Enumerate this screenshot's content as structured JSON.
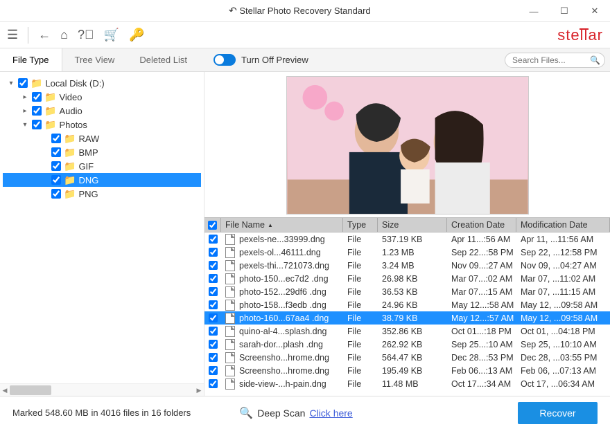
{
  "title": "Stellar Photo Recovery Standard",
  "brand": "stellar",
  "toolbar": {
    "preview_toggle_label": "Turn Off Preview"
  },
  "search": {
    "placeholder": "Search Files..."
  },
  "tabs": {
    "file_type": "File Type",
    "tree_view": "Tree View",
    "deleted_list": "Deleted List"
  },
  "tree": {
    "root": {
      "label": "Local Disk (D:)",
      "expanded": true,
      "checked": true
    },
    "children": [
      {
        "label": "Video",
        "expanded": false,
        "checked": true,
        "has_children": true
      },
      {
        "label": "Audio",
        "expanded": false,
        "checked": true,
        "has_children": true
      },
      {
        "label": "Photos",
        "expanded": true,
        "checked": true,
        "has_children": true,
        "children": [
          {
            "label": "RAW",
            "checked": true
          },
          {
            "label": "BMP",
            "checked": true
          },
          {
            "label": "GIF",
            "checked": true
          },
          {
            "label": "DNG",
            "checked": true,
            "selected": true
          },
          {
            "label": "PNG",
            "checked": true
          }
        ]
      }
    ]
  },
  "grid": {
    "headers": {
      "name": "File Name",
      "type": "Type",
      "size": "Size",
      "cdate": "Creation Date",
      "mdate": "Modification Date"
    },
    "rows": [
      {
        "n": "pexels-ne...33999.dng",
        "t": "File",
        "s": "537.19 KB",
        "c": "Apr 11...:56 AM",
        "m": "Apr 11, ...11:56 AM"
      },
      {
        "n": "pexels-ol...46111.dng",
        "t": "File",
        "s": "1.23 MB",
        "c": "Sep 22...:58 PM",
        "m": "Sep 22, ...12:58 PM"
      },
      {
        "n": "pexels-thi...721073.dng",
        "t": "File",
        "s": "3.24 MB",
        "c": "Nov 09...:27 AM",
        "m": "Nov 09, ...04:27 AM"
      },
      {
        "n": "photo-150...ec7d2 .dng",
        "t": "File",
        "s": "26.98 KB",
        "c": "Mar 07...:02 AM",
        "m": "Mar 07, ...11:02 AM"
      },
      {
        "n": "photo-152...29df6 .dng",
        "t": "File",
        "s": "36.53 KB",
        "c": "Mar 07...:15 AM",
        "m": "Mar 07, ...11:15 AM"
      },
      {
        "n": "photo-158...f3edb .dng",
        "t": "File",
        "s": "24.96 KB",
        "c": "May 12...:58 AM",
        "m": "May 12, ...09:58 AM"
      },
      {
        "n": "photo-160...67aa4 .dng",
        "t": "File",
        "s": "38.79 KB",
        "c": "May 12...:57 AM",
        "m": "May 12, ...09:58 AM",
        "sel": true
      },
      {
        "n": "quino-al-4...splash.dng",
        "t": "File",
        "s": "352.86 KB",
        "c": "Oct 01...:18 PM",
        "m": "Oct 01, ...04:18 PM"
      },
      {
        "n": "sarah-dor...plash .dng",
        "t": "File",
        "s": "262.92 KB",
        "c": "Sep 25...:10 AM",
        "m": "Sep 25, ...10:10 AM"
      },
      {
        "n": "Screensho...hrome.dng",
        "t": "File",
        "s": "564.47 KB",
        "c": "Dec 28...:53 PM",
        "m": "Dec 28, ...03:55 PM"
      },
      {
        "n": "Screensho...hrome.dng",
        "t": "File",
        "s": "195.49 KB",
        "c": "Feb 06...:13 AM",
        "m": "Feb 06, ...07:13 AM"
      },
      {
        "n": "side-view-...h-pain.dng",
        "t": "File",
        "s": "11.48 MB",
        "c": "Oct 17...:34 AM",
        "m": "Oct 17, ...06:34 AM"
      }
    ]
  },
  "status": {
    "marked": "Marked 548.60 MB in 4016 files in 16 folders",
    "deep_label": "Deep Scan",
    "deep_link": "Click here",
    "recover": "Recover"
  }
}
